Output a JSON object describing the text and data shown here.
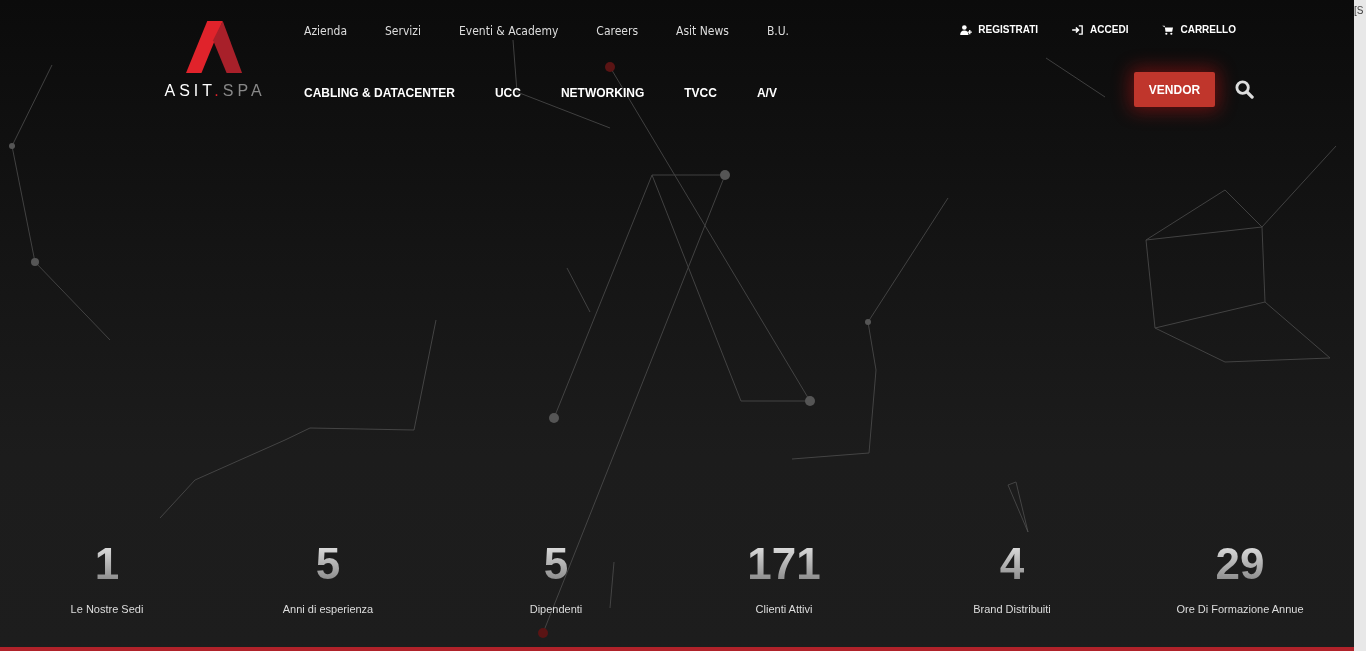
{
  "logo": {
    "name": "ASIT",
    "dot": ".",
    "suffix": "SPA"
  },
  "top_nav": [
    {
      "label": "Azienda"
    },
    {
      "label": "Servizi"
    },
    {
      "label": "Eventi & Academy"
    },
    {
      "label": "Careers"
    },
    {
      "label": "Asit News"
    },
    {
      "label": "B.U."
    }
  ],
  "main_nav": [
    {
      "label": "CABLING & DATACENTER"
    },
    {
      "label": "UCC"
    },
    {
      "label": "NETWORKING"
    },
    {
      "label": "TVCC"
    },
    {
      "label": "A/V"
    }
  ],
  "account_links": [
    {
      "kind": "register",
      "label": "REGISTRATI"
    },
    {
      "kind": "login",
      "label": "ACCEDI"
    },
    {
      "kind": "cart",
      "label": "CARRELLO"
    }
  ],
  "vendor_button": {
    "label": "VENDOR"
  },
  "stats": [
    {
      "value": "1",
      "label": "Le Nostre Sedi"
    },
    {
      "value": "5",
      "label": "Anni di esperienza"
    },
    {
      "value": "5",
      "label": "Dipendenti"
    },
    {
      "value": "171",
      "label": "Clienti Attivi"
    },
    {
      "value": "4",
      "label": "Brand Distribuiti"
    },
    {
      "value": "29",
      "label": "Ore Di Formazione Annue"
    }
  ],
  "side_strip": {
    "text": "[S"
  }
}
